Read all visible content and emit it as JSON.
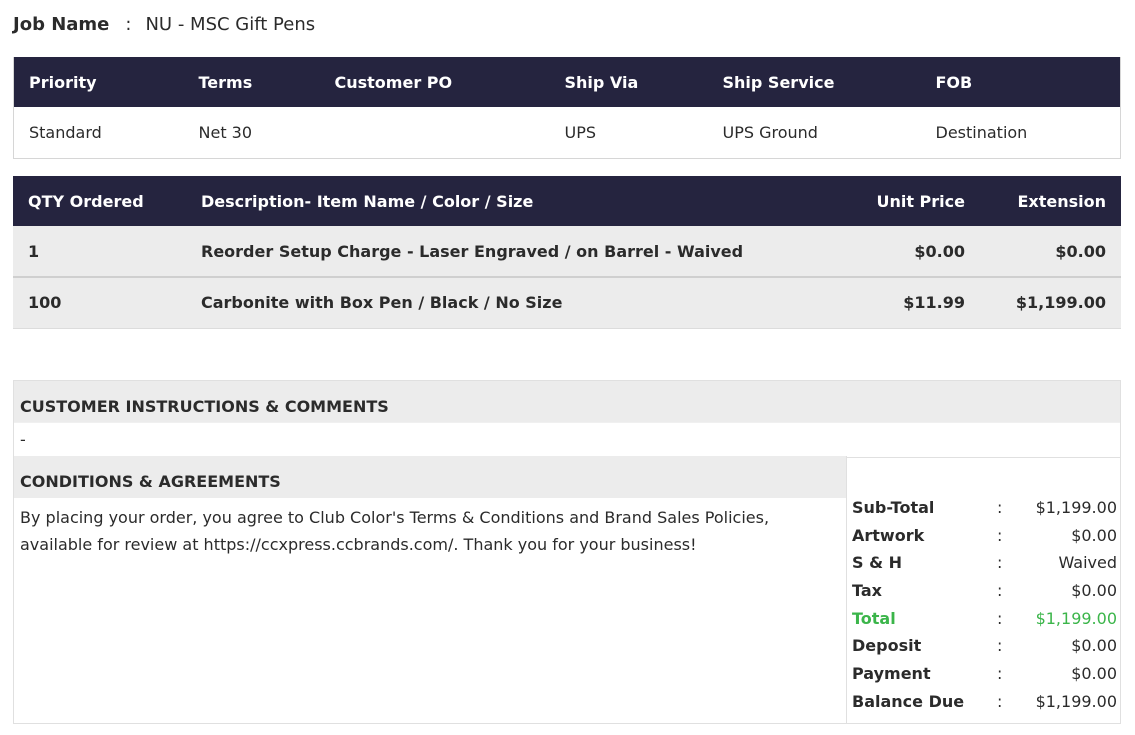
{
  "job": {
    "label": "Job Name",
    "colon": ":",
    "value": "NU - MSC Gift Pens"
  },
  "order_info": {
    "headers": [
      "Priority",
      "Terms",
      "Customer PO",
      "Ship Via",
      "Ship Service",
      "FOB"
    ],
    "values": [
      "Standard",
      "Net 30",
      "",
      "UPS",
      "UPS Ground",
      "Destination"
    ]
  },
  "items": {
    "headers": [
      "QTY Ordered",
      "Description- Item Name / Color / Size",
      "Unit Price",
      "Extension"
    ],
    "rows": [
      [
        "1",
        "Reorder Setup Charge - Laser Engraved / on Barrel - Waived",
        "$0.00",
        "$0.00"
      ],
      [
        "100",
        "Carbonite with Box Pen / Black / No Size",
        "$11.99",
        "$1,199.00"
      ]
    ]
  },
  "instructions": {
    "title": "CUSTOMER INSTRUCTIONS & COMMENTS",
    "text": "-"
  },
  "conditions": {
    "title": "CONDITIONS & AGREEMENTS",
    "text": "By placing your order, you agree to Club Color's Terms & Conditions and Brand Sales Policies, available for review at https://ccxpress.ccbrands.com/. Thank you for your business!"
  },
  "totals": {
    "colon": ":",
    "rows": [
      {
        "label": "Sub-Total",
        "value": "$1,199.00"
      },
      {
        "label": "Artwork",
        "value": "$0.00"
      },
      {
        "label": "S & H",
        "value": "Waived"
      },
      {
        "label": "Tax",
        "value": "$0.00"
      },
      {
        "label": "Total",
        "value": "$1,199.00"
      },
      {
        "label": "Deposit",
        "value": "$0.00"
      },
      {
        "label": "Payment",
        "value": "$0.00"
      },
      {
        "label": "Balance Due",
        "value": "$1,199.00"
      }
    ],
    "highlight_color": "#3bb54a"
  },
  "colors": {
    "header_bg": "#25243f",
    "row_bg": "#ececec"
  }
}
